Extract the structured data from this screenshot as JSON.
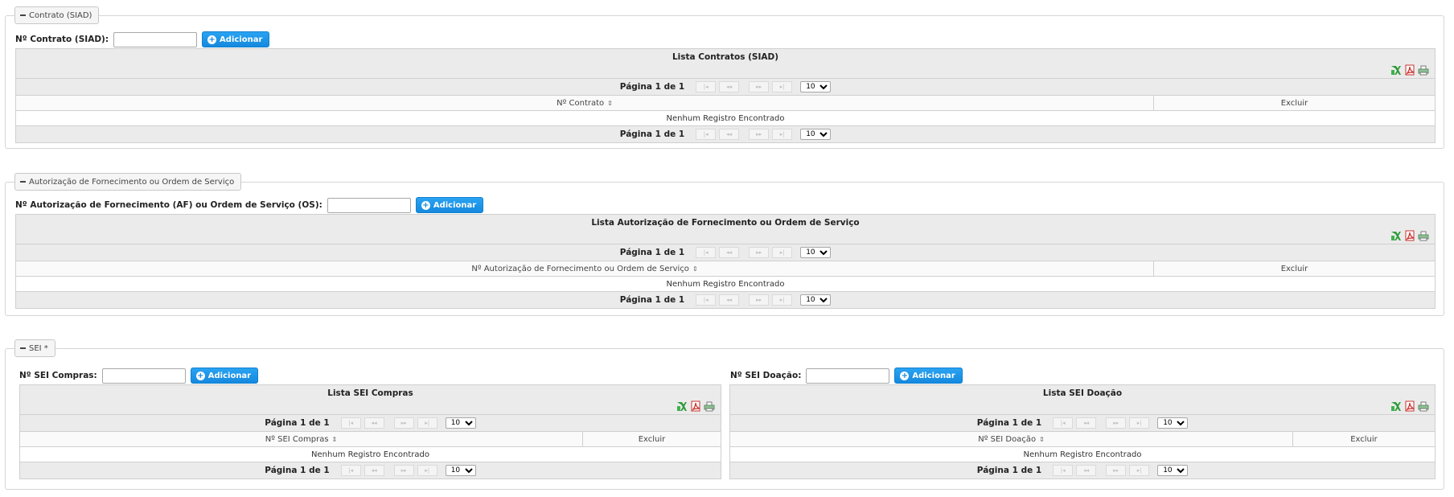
{
  "icons": {
    "excel": "excel-icon",
    "pdf": "pdf-icon",
    "print": "print-icon"
  },
  "pager": {
    "current": "Página 1 de 1",
    "rows_per_page": "10",
    "rows_options": [
      "10"
    ],
    "first": "|◂",
    "prev": "◂◂",
    "next": "▸▸",
    "last": "▸|"
  },
  "empty_message": "Nenhum Registro Encontrado",
  "add_label": "Adicionar",
  "delete_column": "Excluir",
  "contrato": {
    "legend": "Contrato (SIAD)",
    "field_label": "Nº Contrato (SIAD):",
    "field_value": "",
    "table_title": "Lista Contratos (SIAD)",
    "column_1": "Nº Contrato"
  },
  "autorizacao": {
    "legend": "Autorização de Fornecimento ou Ordem de Serviço",
    "field_label": "Nº Autorização de Fornecimento (AF) ou Ordem de Serviço (OS):",
    "field_value": "",
    "table_title": "Lista Autorização de Fornecimento ou Ordem de Serviço",
    "column_1": "Nº Autorização de Fornecimento ou Ordem de Serviço"
  },
  "sei": {
    "legend": "SEI *",
    "compras": {
      "field_label": "Nº SEI Compras:",
      "field_value": "",
      "table_title": "Lista SEI Compras",
      "column_1": "Nº SEI Compras"
    },
    "doacao": {
      "field_label": "Nº SEI Doação:",
      "field_value": "",
      "table_title": "Lista SEI Doação",
      "column_1": "Nº SEI Doação"
    }
  }
}
